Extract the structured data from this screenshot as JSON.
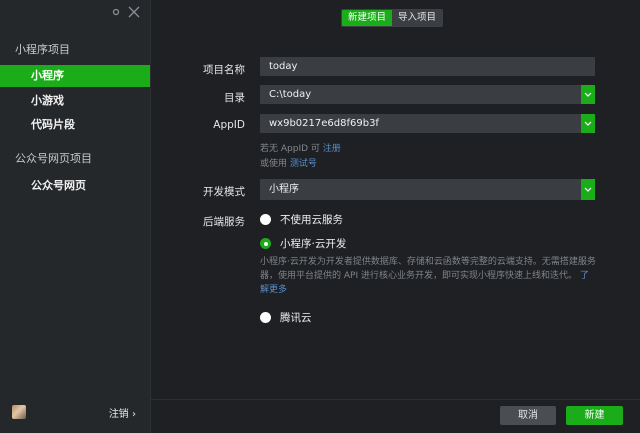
{
  "sidebar": {
    "section_miniprogram": "小程序项目",
    "items_miniprogram": [
      {
        "label": "小程序",
        "active": true
      },
      {
        "label": "小游戏",
        "active": false
      },
      {
        "label": "代码片段",
        "active": false
      }
    ],
    "section_official": "公众号网页项目",
    "items_official": [
      {
        "label": "公众号网页",
        "active": false
      }
    ],
    "footer": {
      "logout_label": "注销 ›"
    },
    "icons": {
      "settings": "settings-icon",
      "close": "close-icon",
      "avatar": "avatar"
    }
  },
  "tabs": [
    {
      "label": "新建项目",
      "active": true
    },
    {
      "label": "导入项目",
      "active": false
    }
  ],
  "form": {
    "project_name": {
      "label": "项目名称",
      "value": "today"
    },
    "directory": {
      "label": "目录",
      "value": "C:\\today"
    },
    "appid": {
      "label": "AppID",
      "value": "wx9b0217e6d8f69b3f"
    },
    "appid_hint_line1": "若无 AppID 可 ",
    "appid_hint_link1": "注册",
    "appid_hint_line2": "或使用 ",
    "appid_hint_link2": "测试号",
    "dev_mode": {
      "label": "开发模式",
      "value": "小程序"
    },
    "backend": {
      "label": "后端服务",
      "options": [
        {
          "label": "不使用云服务",
          "selected": false
        },
        {
          "label": "小程序·云开发",
          "selected": true
        },
        {
          "label": "腾讯云",
          "selected": false
        }
      ],
      "cloud_desc": "小程序·云开发为开发者提供数据库、存储和云函数等完整的云端支持。无需搭建服务器，使用平台提供的 API 进行核心业务开发，即可实现小程序快速上线和迭代。",
      "cloud_desc_link": "了解更多"
    }
  },
  "buttons": {
    "cancel": "取消",
    "create": "新建"
  },
  "colors": {
    "accent": "#1aad19",
    "sidebar_bg": "#25282b",
    "main_bg": "#1e2023",
    "field_bg": "#3a3e43",
    "link": "#5b8ec9"
  }
}
